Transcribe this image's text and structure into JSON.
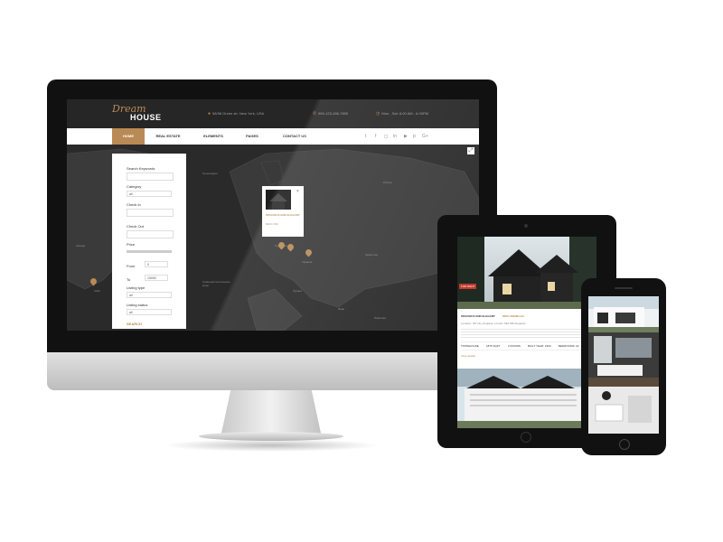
{
  "site": {
    "logo_script": "Dream",
    "logo_main": "HOUSE",
    "address": "58/98 Green str. New York, USA",
    "phone": "890-123-456-7890",
    "hours": "Mon - Sat: 8.00 AM - 6.00PM"
  },
  "nav": {
    "items": [
      "HOME",
      "REAL ESTATE",
      "ELEMENTS",
      "PAGES",
      "CONTACT US"
    ],
    "social": [
      "twitter-icon",
      "facebook-icon",
      "instagram-icon",
      "linkedin-icon",
      "youtube-icon",
      "pinterest-icon",
      "google-plus-icon"
    ]
  },
  "search": {
    "keywords_label": "Search Keywords",
    "category_label": "Category",
    "category_value": "all",
    "checkin_label": "Check In",
    "checkout_label": "Check Out",
    "price_label": "Price",
    "from_label": "From",
    "from_value": "0",
    "to_label": "To",
    "to_value": "15000",
    "listing_type_label": "Listing type",
    "listing_type_value": "all",
    "listing_status_label": "Listing status",
    "listing_status_value": "all",
    "search_button": "SEARCH"
  },
  "map": {
    "popup_title": "SPACIOUS AND ELEGANT",
    "popup_price": "$300 USD"
  },
  "tablet": {
    "badge": "FOR RENT",
    "title": "SPACIOUS AND ELEGANT",
    "price": "$300 USD/Month",
    "meta": "Location: 3D City, England, London SE2 0BJ England",
    "features": [
      "TOWNHOUSE",
      "1875 SQFT",
      "2 ROOMS",
      "BUILT YEAR: 1950",
      "BEDROOMS: 02"
    ],
    "link": "View details"
  }
}
